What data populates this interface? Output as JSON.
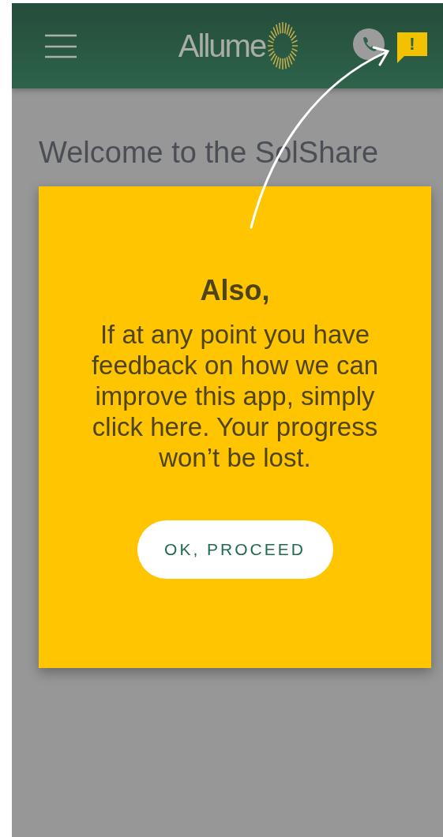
{
  "header": {
    "logo": "Allume",
    "feedback_badge": "!"
  },
  "intro": "Welcome to the SolShare",
  "dialog": {
    "title": "Also,",
    "message": "If at any point you have feedback on how we can improve this app, simply click here. Your progress won’t be lost.",
    "button": "OK, PROCEED"
  }
}
